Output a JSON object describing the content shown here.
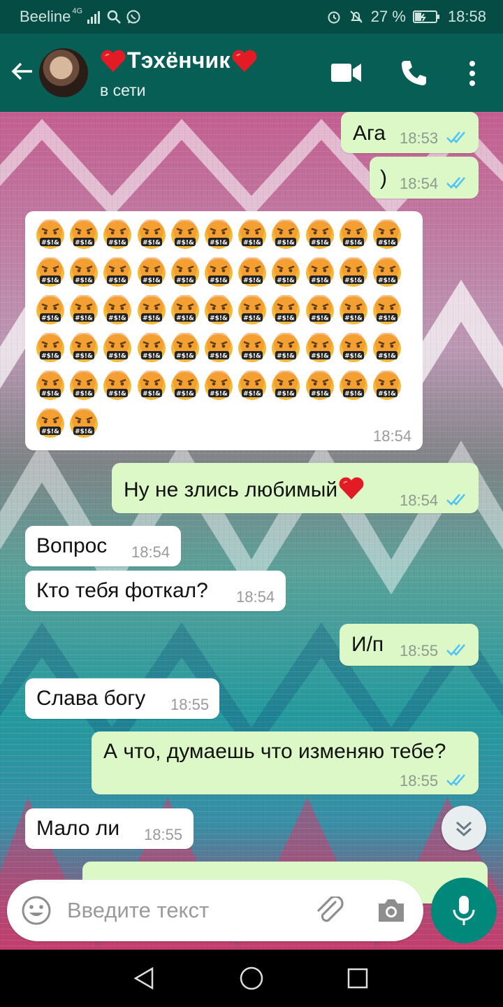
{
  "status_bar": {
    "carrier": "Beeline",
    "network": "4G",
    "battery": "27 %",
    "time": "18:58",
    "icons": [
      "signal-icon",
      "search-icon",
      "whatsapp-icon",
      "alarm-icon",
      "mute-icon",
      "battery-icon"
    ]
  },
  "header": {
    "contact_name": "Тэхёнчик",
    "status": "в сети",
    "icons": [
      "back-arrow-icon",
      "avatar",
      "video-call-icon",
      "phone-icon",
      "more-icon"
    ]
  },
  "messages": [
    {
      "dir": "out",
      "text": "Ага",
      "time": "18:53",
      "read": true
    },
    {
      "dir": "out",
      "text": ")",
      "time": "18:54",
      "read": true
    },
    {
      "dir": "in",
      "kind": "emoji",
      "emoji": "face-with-symbols-on-mouth",
      "count": 57,
      "time": "18:54"
    },
    {
      "dir": "out",
      "text": "Ну не злись любимый",
      "time": "18:54",
      "read": true
    },
    {
      "dir": "in",
      "text": "Вопрос",
      "time": "18:54"
    },
    {
      "dir": "in",
      "text": "Кто тебя фоткал?",
      "time": "18:54"
    },
    {
      "dir": "out",
      "text": "И/п",
      "time": "18:55",
      "read": true
    },
    {
      "dir": "in",
      "text": "Слава богу",
      "time": "18:55"
    },
    {
      "dir": "out",
      "text": "А что, думаешь что изменяю тебе?",
      "time": "18:55",
      "read": true
    },
    {
      "dir": "in",
      "text": "Мало ли",
      "time": "18:55"
    }
  ],
  "input": {
    "placeholder": "Введите текст",
    "icons": [
      "emoji-icon",
      "attach-icon",
      "camera-icon",
      "mic-icon"
    ]
  },
  "colors": {
    "header": "#075e54",
    "status_bar": "#054d44",
    "outgoing_bubble": "#dcf8c6",
    "incoming_bubble": "#ffffff",
    "read_ticks": "#4fc3f7",
    "accent": "#00897b"
  }
}
